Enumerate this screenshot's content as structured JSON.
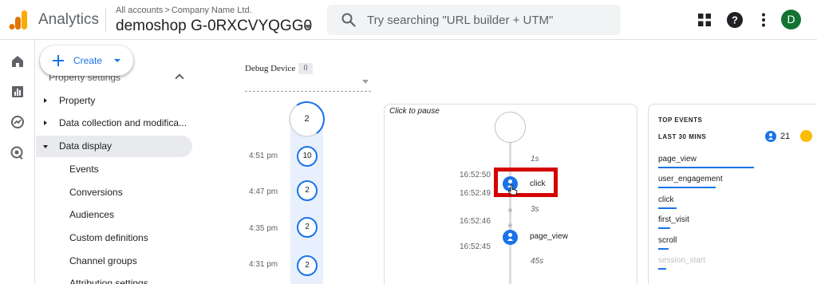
{
  "app": {
    "title": "Analytics",
    "breadcrumb": {
      "all_accounts": "All accounts",
      "separator": ">",
      "account": "Company Name Ltd."
    },
    "property": "demoshop G-0RXCVYQGG0",
    "search_placeholder": "Try searching \"URL builder + UTM\"",
    "avatar_initial": "D",
    "colors": {
      "brand_orange": "#f9ab00",
      "brand_dark_orange": "#e37400",
      "accent_blue": "#1a73e8",
      "avatar_green": "#137333",
      "highlight_red": "#d50000"
    }
  },
  "create": {
    "label": "Create"
  },
  "sidebar": {
    "section": "Property settings",
    "items": [
      {
        "label": "Property",
        "expanded": false
      },
      {
        "label": "Data collection and modifica...",
        "expanded": false
      },
      {
        "label": "Data display",
        "expanded": true,
        "active": true
      }
    ],
    "subitems": [
      "Events",
      "Conversions",
      "Audiences",
      "Custom definitions",
      "Channel groups",
      "Attribution settings"
    ]
  },
  "debug": {
    "device_label": "Debug Device",
    "device_count": "0",
    "minutes": {
      "current": "2",
      "rows": [
        {
          "time": "4:51 pm",
          "count": "10"
        },
        {
          "time": "",
          "count": "2"
        },
        {
          "time": "4:47 pm",
          "count": "2"
        },
        {
          "time": "4:35 pm",
          "count": "2"
        },
        {
          "time": "4:31 pm",
          "count": "2"
        }
      ]
    },
    "seconds": {
      "pause_text": "Click to pause",
      "gaps": [
        "1s",
        "3s",
        "45s"
      ],
      "times": [
        "16:52:50",
        "16:52:49",
        "16:52:46",
        "16:52:45"
      ],
      "events": [
        "click",
        "page_view"
      ]
    },
    "top_events": {
      "title": "TOP EVENTS",
      "period": "LAST 30 MINS",
      "user_count": "21",
      "events": [
        {
          "name": "page_view",
          "share": 0.63
        },
        {
          "name": "user_engagement",
          "share": 0.38
        },
        {
          "name": "click",
          "share": 0.12
        },
        {
          "name": "first_visit",
          "share": 0.08
        },
        {
          "name": "scroll",
          "share": 0.07
        },
        {
          "name": "session_start",
          "share": 0.05
        }
      ]
    }
  }
}
